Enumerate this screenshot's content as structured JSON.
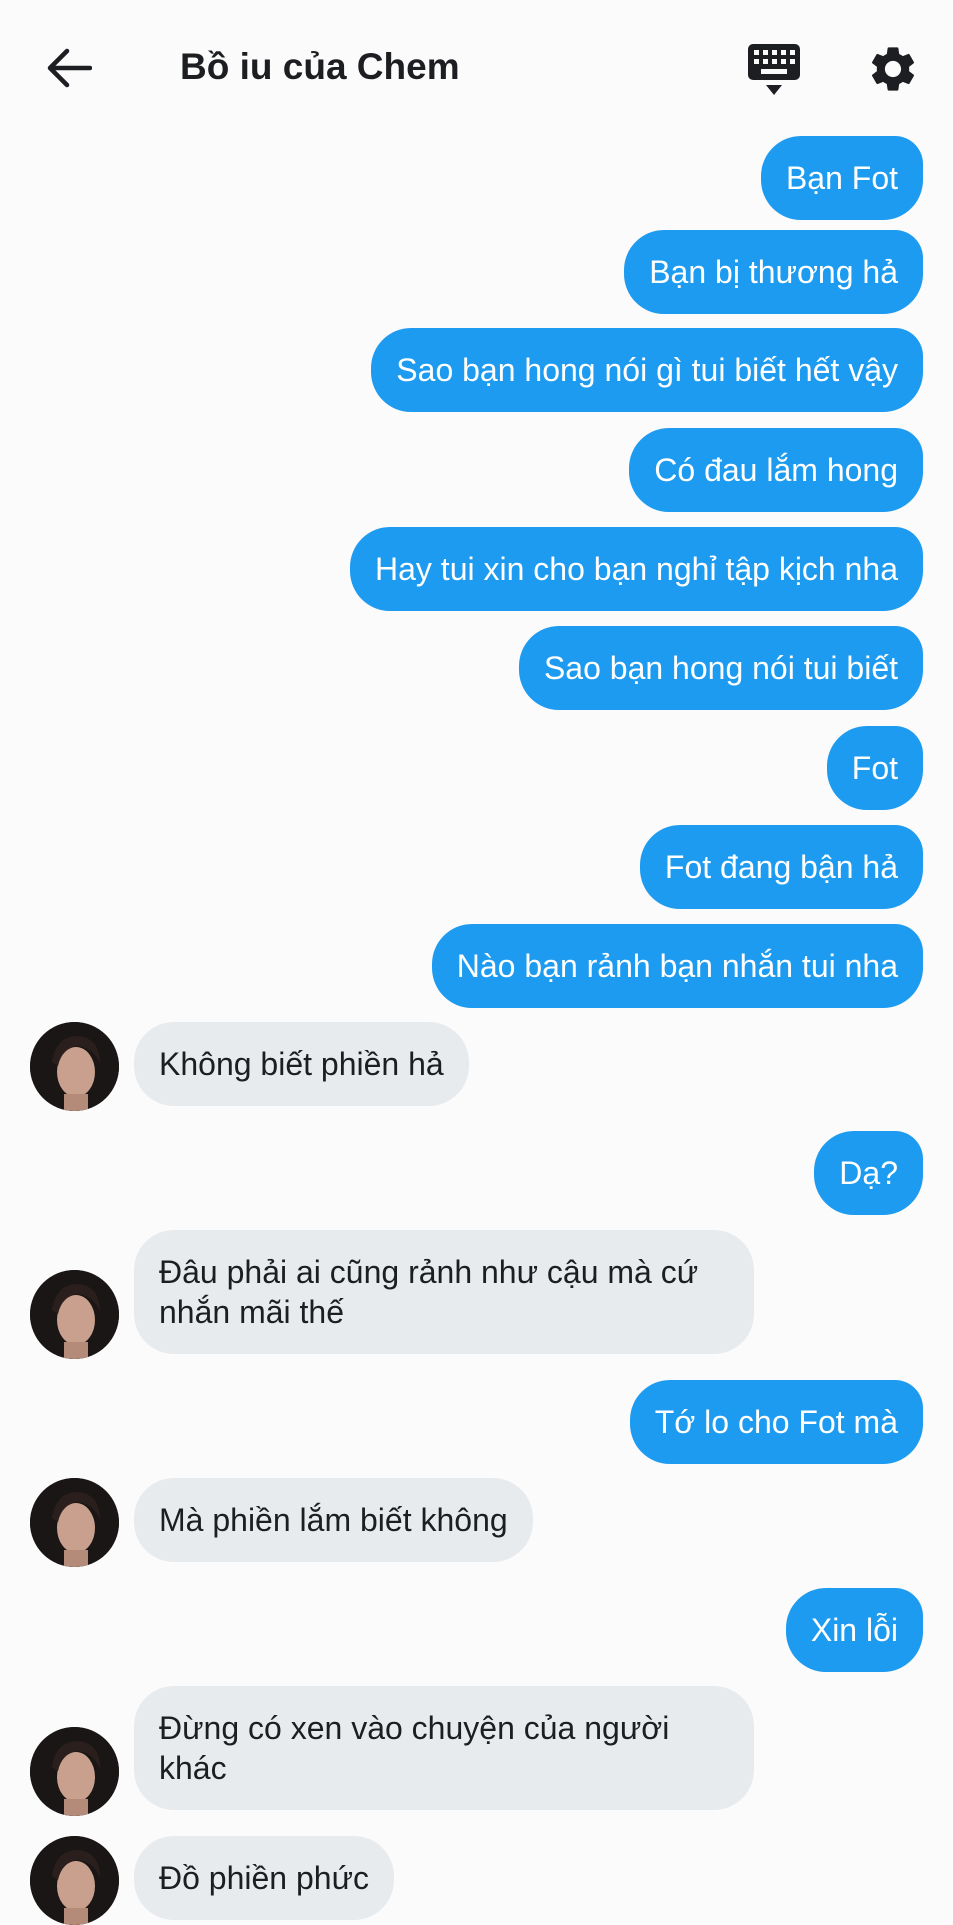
{
  "header": {
    "title": "Bồ iu của Chem",
    "back_icon": "arrow-left-icon",
    "keyboard_icon": "keyboard-icon",
    "settings_icon": "gear-icon"
  },
  "colors": {
    "outgoing_bubble": "#1d9bf0",
    "incoming_bubble": "#e8ebee",
    "background": "#fbfbfc"
  },
  "messages": [
    {
      "from": "me",
      "text": "Bạn Fot"
    },
    {
      "from": "me",
      "text": "Bạn bị thương hả"
    },
    {
      "from": "me",
      "text": "Sao bạn hong nói gì tui biết hết vậy"
    },
    {
      "from": "me",
      "text": "Có đau lắm hong"
    },
    {
      "from": "me",
      "text": "Hay tui xin cho bạn nghỉ tập kịch nha"
    },
    {
      "from": "me",
      "text": "Sao bạn hong nói tui biết"
    },
    {
      "from": "me",
      "text": "Fot"
    },
    {
      "from": "me",
      "text": "Fot đang bận hả"
    },
    {
      "from": "me",
      "text": "Nào bạn rảnh bạn nhắn tui nha"
    },
    {
      "from": "them",
      "text": "Không biết phiền hả"
    },
    {
      "from": "me",
      "text": "Dạ?"
    },
    {
      "from": "them",
      "text": "Đâu phải ai cũng rảnh như cậu mà cứ nhắn mãi thế"
    },
    {
      "from": "me",
      "text": "Tớ lo cho Fot mà"
    },
    {
      "from": "them",
      "text": "Mà phiền lắm biết không"
    },
    {
      "from": "me",
      "text": "Xin lỗi"
    },
    {
      "from": "them",
      "text": "Đừng có xen vào chuyện của người khác"
    },
    {
      "from": "them",
      "text": "Đồ phiền phức"
    }
  ]
}
